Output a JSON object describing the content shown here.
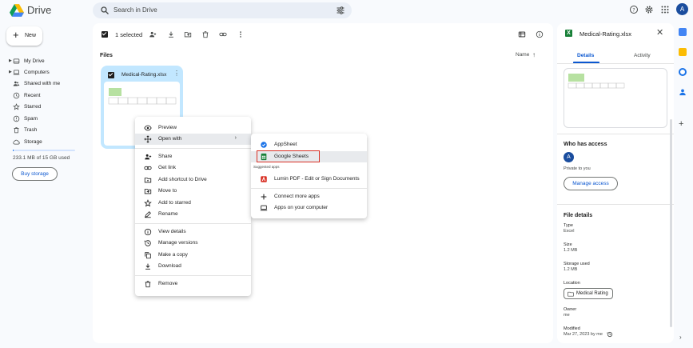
{
  "app": {
    "name": "Drive"
  },
  "search": {
    "placeholder": "Search in Drive"
  },
  "user": {
    "initial": "A"
  },
  "sidebar": {
    "new_label": "New",
    "items": [
      {
        "label": "My Drive"
      },
      {
        "label": "Computers"
      },
      {
        "label": "Shared with me"
      },
      {
        "label": "Recent"
      },
      {
        "label": "Starred"
      },
      {
        "label": "Spam"
      },
      {
        "label": "Trash"
      },
      {
        "label": "Storage"
      }
    ],
    "storage_text": "233.1 MB of 15 GB used",
    "storage_used_fraction": 0.016,
    "buy_storage": "Buy storage"
  },
  "toolbar": {
    "selected_text": "1 selected"
  },
  "files": {
    "section_label": "Files",
    "sort_label": "Name",
    "file_name": "Medical-Rating.xlsx"
  },
  "context_menu": {
    "items": [
      {
        "label": "Preview",
        "icon": "eye-icon"
      },
      {
        "label": "Open with",
        "icon": "move-arrows-icon"
      },
      {
        "label": "Share",
        "icon": "person-add-icon"
      },
      {
        "label": "Get link",
        "icon": "link-icon"
      },
      {
        "label": "Add shortcut to Drive",
        "icon": "shortcut-icon"
      },
      {
        "label": "Move to",
        "icon": "folder-move-icon"
      },
      {
        "label": "Add to starred",
        "icon": "star-icon"
      },
      {
        "label": "Rename",
        "icon": "pencil-icon"
      },
      {
        "label": "View details",
        "icon": "info-icon"
      },
      {
        "label": "Manage versions",
        "icon": "history-icon"
      },
      {
        "label": "Make a copy",
        "icon": "copy-icon"
      },
      {
        "label": "Download",
        "icon": "download-icon"
      },
      {
        "label": "Remove",
        "icon": "trash-icon"
      }
    ]
  },
  "submenu": {
    "items": [
      {
        "label": "AppSheet"
      },
      {
        "label": "Google Sheets"
      },
      {
        "label": "Lumin PDF - Edit or Sign Documents"
      },
      {
        "label": "Connect more apps"
      },
      {
        "label": "Apps on your computer"
      }
    ],
    "suggested_caption": "Suggested apps"
  },
  "details": {
    "title": "Medical-Rating.xlsx",
    "tabs": [
      "Details",
      "Activity"
    ],
    "who_has_access": "Who has access",
    "access_avatar": "A",
    "private_text": "Private to you",
    "manage_access": "Manage access",
    "file_details_heading": "File details",
    "fields": [
      {
        "label": "Type",
        "value": "Excel"
      },
      {
        "label": "Size",
        "value": "1.2 MB"
      },
      {
        "label": "Storage used",
        "value": "1.2 MB"
      }
    ],
    "location_label": "Location",
    "location_value": "Medical Rating",
    "owner_label": "Owner",
    "owner_value": "me",
    "modified_label": "Modified",
    "modified_value": "Mar 27, 2023 by me"
  },
  "colors": {
    "accent": "#0b57d0",
    "selected_card": "#c2e7ff",
    "highlight_box": "#d93025",
    "excel_green": "#188038"
  }
}
